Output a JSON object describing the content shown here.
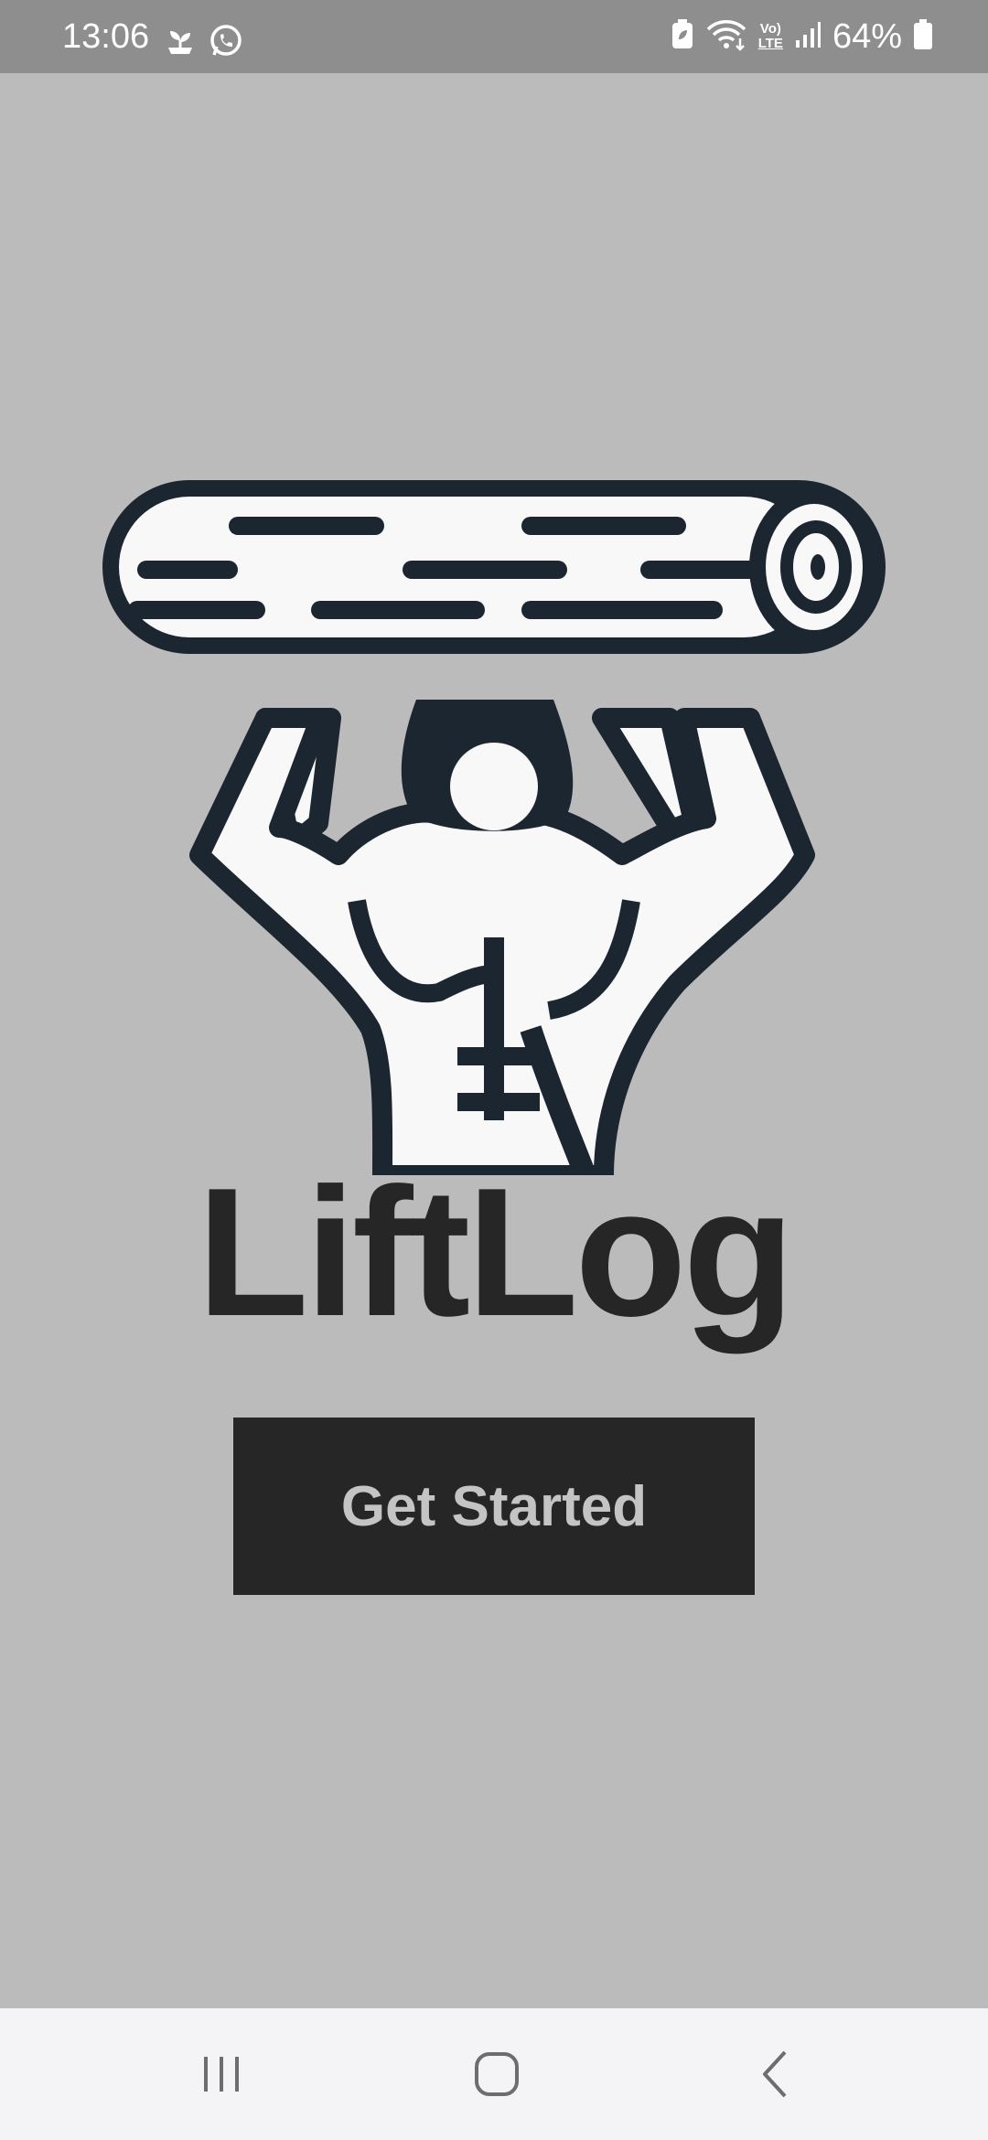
{
  "status_bar": {
    "time": "13:06",
    "left_icons": [
      "plant-notification-icon",
      "whatsapp-icon"
    ],
    "right_icons": [
      "battery-saver-icon",
      "wifi-icon",
      "volte-icon",
      "signal-icon",
      "battery-icon"
    ],
    "volte_label_top": "Vo)",
    "volte_label_bottom": "LTE",
    "battery_percent": "64%"
  },
  "app": {
    "logo_icon": "strongman-lifting-log-icon",
    "title": "LiftLog",
    "cta_label": "Get Started"
  },
  "colors": {
    "background": "#bbbbbb",
    "status_bar": "#8e8e8e",
    "title": "#262626",
    "button_bg": "#262626",
    "button_text": "#c4c4c4",
    "logo_outline": "#1c2630",
    "nav_bar": "#f4f4f6"
  },
  "nav_bar": {
    "items": [
      "recent-apps-icon",
      "home-icon",
      "back-icon"
    ]
  }
}
